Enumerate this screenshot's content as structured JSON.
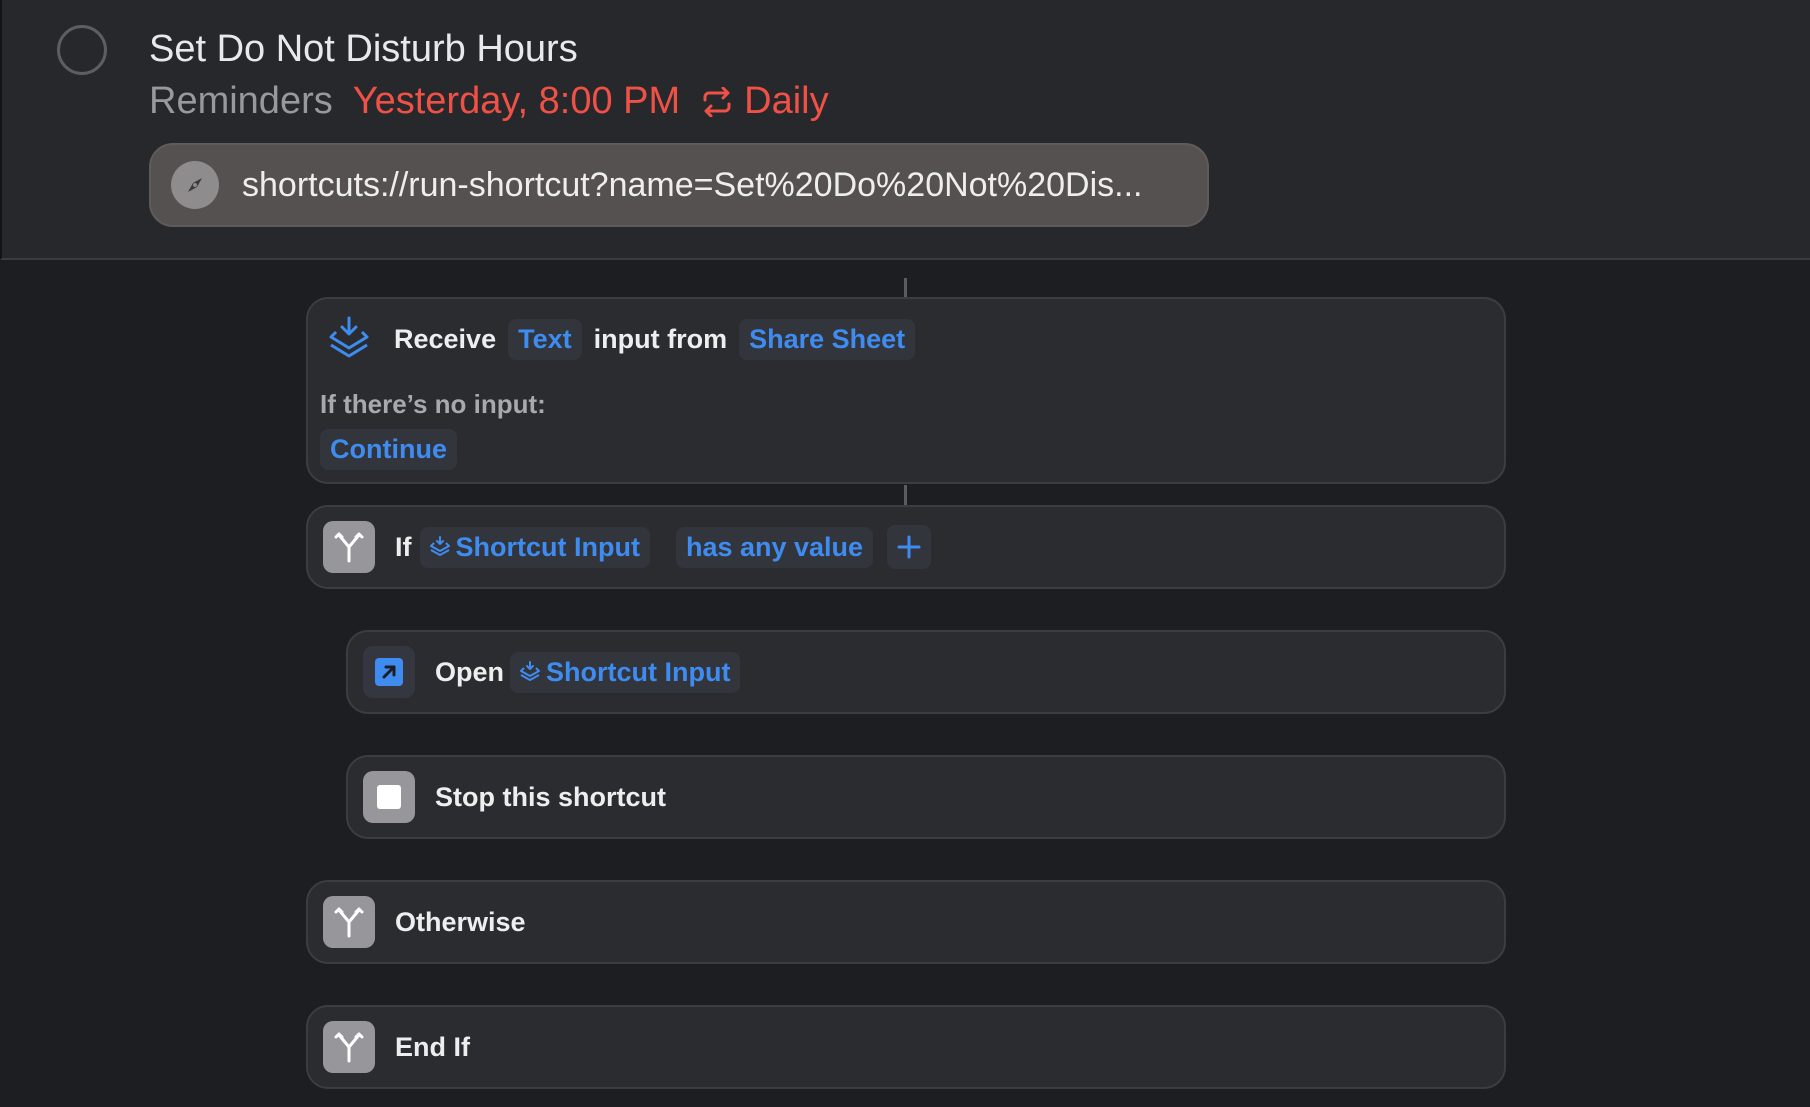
{
  "reminder": {
    "title": "Set Do Not Disturb Hours",
    "list": "Reminders",
    "date": "Yesterday, 8:00 PM",
    "repeat": "Daily",
    "url": "shortcuts://run-shortcut?name=Set%20Do%20Not%20Dis...",
    "url_icon": "compass-icon",
    "accent_color": "#ef5146"
  },
  "shortcut": {
    "receive": {
      "verb": "Receive",
      "type": "Text",
      "mid": "input from",
      "source": "Share Sheet",
      "no_input_label": "If there’s no input:",
      "no_input_action": "Continue"
    },
    "if_block": {
      "keyword": "If",
      "variable": "Shortcut Input",
      "condition": "has any value"
    },
    "open_action": {
      "verb": "Open",
      "variable": "Shortcut Input"
    },
    "stop_action": {
      "label": "Stop this shortcut"
    },
    "otherwise": {
      "label": "Otherwise"
    },
    "end_if": {
      "label": "End If"
    },
    "token_color": "#3f8cf0"
  }
}
